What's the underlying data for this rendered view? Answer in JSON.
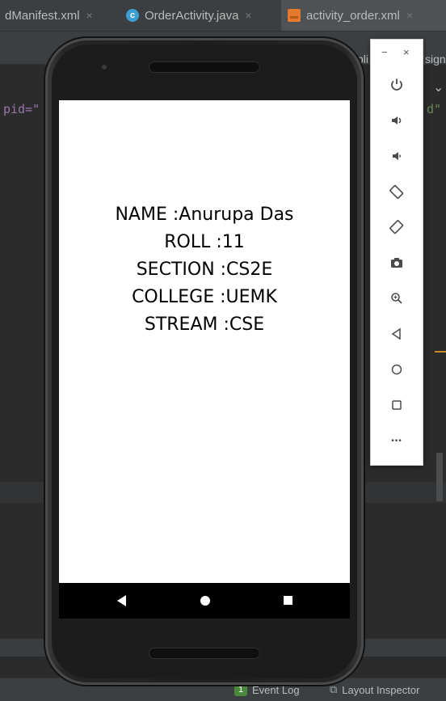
{
  "tabs": [
    {
      "label": "dManifest.xml",
      "close": "×"
    },
    {
      "label": "OrderActivity.java",
      "close": "×",
      "icon_letter": "c"
    },
    {
      "label": "activity_order.xml",
      "close": "×"
    }
  ],
  "ide": {
    "code_left": "pid=\"",
    "code_right": "d\"",
    "toolbar_fragment_1": "pli",
    "toolbar_fragment_2": "sign",
    "chevron": "⌄"
  },
  "status_bar": {
    "event_log_badge": "1",
    "event_log": "Event Log",
    "layout_inspector": "Layout Inspector"
  },
  "app": {
    "lines": [
      "NAME :Anurupa Das",
      "ROLL :11",
      "SECTION :CS2E",
      "COLLEGE :UEMK",
      "STREAM :CSE"
    ]
  },
  "emulator_tools": {
    "minimize": "−",
    "close": "×",
    "more": "•••"
  },
  "colors": {
    "ide_bg": "#2b2b2b",
    "tab_bar": "#3c3f41",
    "java_icon": "#3d9fd1",
    "xml_icon": "#e37a2c"
  }
}
